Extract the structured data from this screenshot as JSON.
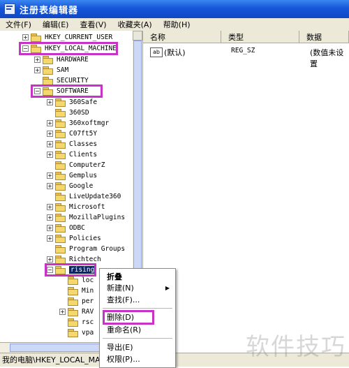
{
  "window": {
    "title": "注册表编辑器"
  },
  "menu": [
    "文件(F)",
    "编辑(E)",
    "查看(V)",
    "收藏夹(A)",
    "帮助(H)"
  ],
  "columns": {
    "name": "名称",
    "type": "类型",
    "data": "数据"
  },
  "value_row": {
    "name": "(默认)",
    "type": "REG_SZ",
    "data": "(数值未设置"
  },
  "tree_nodes": [
    {
      "label": "HKEY_CURRENT_USER",
      "expander": "+"
    },
    {
      "label": "HKEY_LOCAL_MACHINE",
      "expander": "−"
    },
    {
      "label": "HARDWARE",
      "expander": "+"
    },
    {
      "label": "SAM",
      "expander": "+"
    },
    {
      "label": "SECURITY",
      "expander": ""
    },
    {
      "label": "SOFTWARE",
      "expander": "−"
    },
    {
      "label": "360Safe",
      "expander": "+"
    },
    {
      "label": "360SD",
      "expander": ""
    },
    {
      "label": "360xoftmgr",
      "expander": "+"
    },
    {
      "label": "C07ft5Y",
      "expander": "+"
    },
    {
      "label": "Classes",
      "expander": "+"
    },
    {
      "label": "Clients",
      "expander": "+"
    },
    {
      "label": "ComputerZ",
      "expander": ""
    },
    {
      "label": "Gemplus",
      "expander": "+"
    },
    {
      "label": "Google",
      "expander": "+"
    },
    {
      "label": "LiveUpdate360",
      "expander": ""
    },
    {
      "label": "Microsoft",
      "expander": "+"
    },
    {
      "label": "MozillaPlugins",
      "expander": "+"
    },
    {
      "label": "ODBC",
      "expander": "+"
    },
    {
      "label": "Policies",
      "expander": "+"
    },
    {
      "label": "Program Groups",
      "expander": ""
    },
    {
      "label": "Richtech",
      "expander": "+"
    },
    {
      "label": "rising",
      "expander": "−"
    },
    {
      "label": "loc",
      "expander": ""
    },
    {
      "label": "Min",
      "expander": ""
    },
    {
      "label": "per",
      "expander": ""
    },
    {
      "label": "RAV",
      "expander": "+"
    },
    {
      "label": "rsc",
      "expander": ""
    },
    {
      "label": "vpa",
      "expander": ""
    }
  ],
  "context_menu": {
    "collapse": "折叠",
    "new": "新建(N)",
    "find": "查找(F)...",
    "delete": "删除(D)",
    "rename": "重命名(R)",
    "export": "导出(E)",
    "permissions": "权限(P)..."
  },
  "status": "我的电脑\\HKEY_LOCAL_MAC",
  "watermark": "软件技巧"
}
